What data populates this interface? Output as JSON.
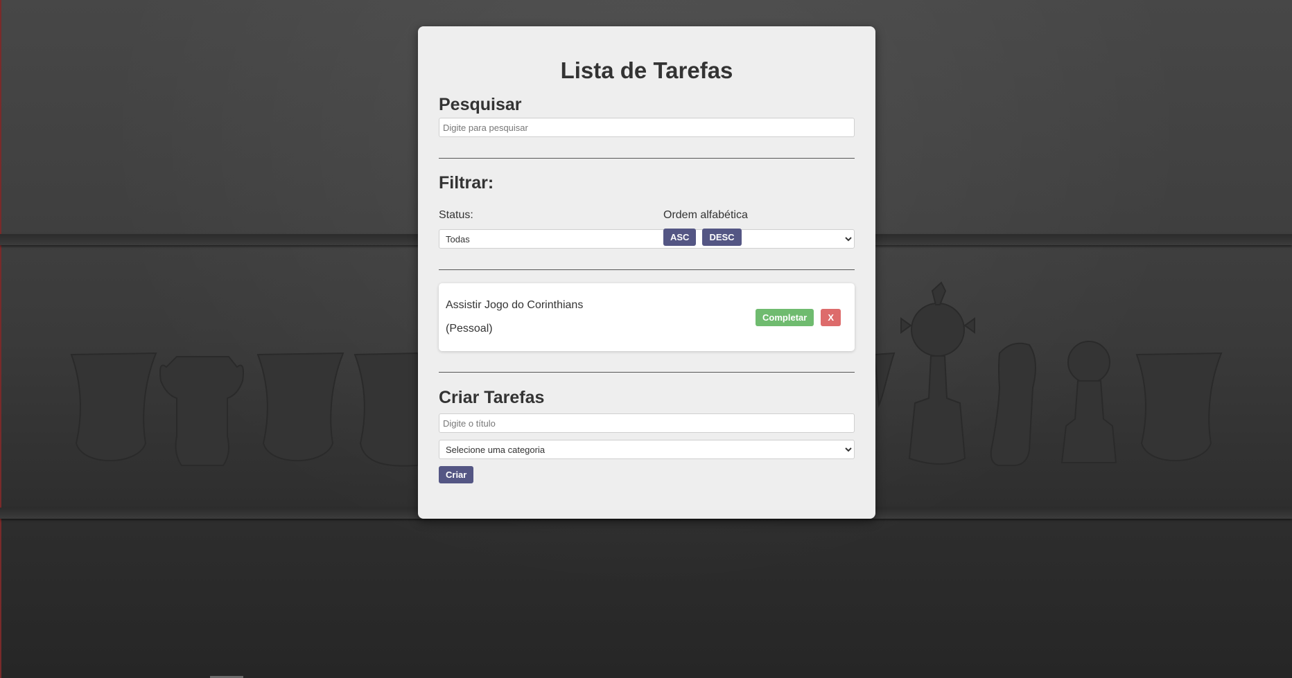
{
  "app": {
    "title": "Lista de Tarefas"
  },
  "search": {
    "heading": "Pesquisar",
    "placeholder": "Digite para pesquisar",
    "value": ""
  },
  "filter": {
    "heading": "Filtrar:",
    "status_label": "Status:",
    "status_selected": "Todas",
    "order_label": "Ordem alfabética",
    "asc_label": "ASC",
    "desc_label": "DESC"
  },
  "tasks": [
    {
      "title": "Assistir Jogo do Corinthians",
      "category": "(Pessoal)",
      "complete_label": "Completar",
      "remove_label": "X"
    }
  ],
  "create": {
    "heading": "Criar Tarefas",
    "title_placeholder": "Digite o título",
    "category_selected": "Selecione uma categoria",
    "submit_label": "Criar"
  },
  "colors": {
    "primary_button": "#545684",
    "complete_button": "#6fbb6f",
    "remove_button": "#dd6b6b",
    "card_background": "#eeeeee"
  }
}
